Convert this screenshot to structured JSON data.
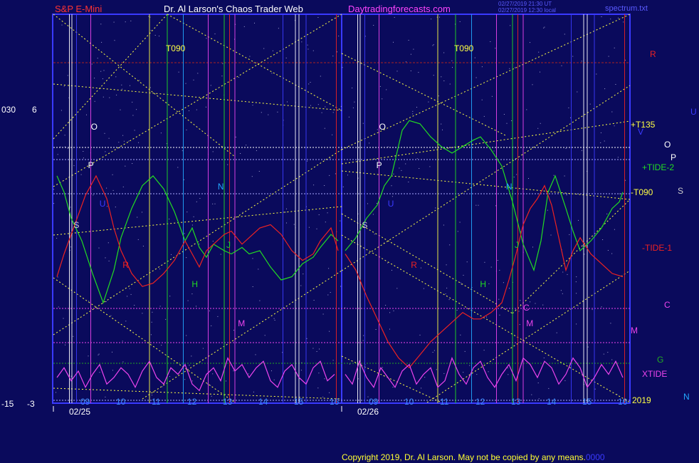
{
  "header": {
    "symbol": "S&P E-Mini",
    "title": "Dr. Al Larson's Chaos Trader Web",
    "site": "Daytradingforecasts.com",
    "stamp1": "02/27/2019 21:30 UT",
    "stamp2": "02/27/2019 12:30 local",
    "file": "spectrum.txt"
  },
  "colors": {
    "background": "#0a0a5c",
    "frame": "#3a3aff",
    "symbol": "#ff3333",
    "title": "#ffffff",
    "site": "#ff44ff",
    "green": "#22dd22",
    "red": "#ee2222",
    "magenta": "#ee44ee",
    "yellow": "#ffff44"
  },
  "left_axis": {
    "top_outer": "030",
    "top_inner": "6",
    "bottom_outer": "-15",
    "bottom_inner": "-3"
  },
  "right_labels": [
    "R",
    "U",
    "+T135",
    "V",
    "O",
    "P",
    "+TIDE-2",
    "-T090",
    "S",
    "-TIDE-1",
    "C",
    "M",
    "G",
    "XTIDE",
    "2019",
    "N"
  ],
  "copyright": "Copyright 2019, Dr. Al Larson. May not be copied by any means.",
  "copyright_tail": "0000",
  "chart_data": [
    {
      "type": "line",
      "title": "S&P E-Mini",
      "date": "02/25",
      "x_hours": [
        "09",
        "10",
        "11",
        "12",
        "13",
        "14",
        "15",
        "16"
      ],
      "ylim": [
        -3,
        6
      ],
      "annotations": [
        "T090",
        "O",
        "P",
        "S",
        "R",
        "U",
        "N",
        "H",
        "J",
        "M"
      ],
      "series": [
        {
          "name": "TIDE",
          "color": "green",
          "x": [
            8.2,
            8.4,
            8.6,
            8.9,
            9.2,
            9.5,
            9.8,
            10.0,
            10.3,
            10.6,
            10.9,
            11.2,
            11.5,
            11.8,
            12.0,
            12.2,
            12.4,
            12.6,
            12.9,
            13.1,
            13.4,
            13.6,
            13.9,
            14.2,
            14.5,
            14.8,
            15.1,
            15.4,
            15.6,
            15.9,
            16.1
          ],
          "values": [
            3.9,
            3.4,
            2.6,
            1.9,
            0.9,
            0.0,
            1.0,
            2.0,
            2.9,
            3.6,
            3.9,
            3.5,
            2.8,
            1.9,
            2.3,
            1.7,
            1.4,
            1.8,
            1.6,
            1.5,
            1.7,
            1.5,
            1.6,
            1.1,
            0.7,
            0.8,
            1.2,
            1.4,
            1.7,
            2.1,
            1.9
          ]
        },
        {
          "name": "TIDE-1",
          "color": "red",
          "x": [
            8.2,
            8.4,
            8.7,
            9.0,
            9.3,
            9.6,
            9.8,
            10.0,
            10.3,
            10.6,
            10.9,
            11.2,
            11.5,
            11.8,
            12.0,
            12.2,
            12.4,
            12.6,
            12.9,
            13.1,
            13.4,
            13.6,
            13.9,
            14.2,
            14.5,
            14.8,
            15.1,
            15.4,
            15.6,
            15.9,
            16.1
          ],
          "values": [
            0.8,
            1.5,
            2.4,
            3.3,
            3.9,
            3.2,
            2.3,
            1.6,
            0.9,
            0.5,
            0.6,
            0.9,
            1.3,
            1.9,
            1.5,
            1.1,
            1.6,
            1.8,
            2.1,
            2.2,
            1.8,
            2.0,
            2.3,
            2.4,
            2.1,
            1.6,
            1.3,
            1.5,
            1.9,
            2.3,
            1.6
          ]
        },
        {
          "name": "XTIDE",
          "color": "magenta",
          "x": [
            8.2,
            8.4,
            8.6,
            8.8,
            9.0,
            9.2,
            9.4,
            9.6,
            9.8,
            10.0,
            10.2,
            10.4,
            10.6,
            10.8,
            11.0,
            11.2,
            11.4,
            11.6,
            11.8,
            12.0,
            12.2,
            12.4,
            12.6,
            12.8,
            13.0,
            13.2,
            13.4,
            13.6,
            13.8,
            14.0,
            14.2,
            14.4,
            14.6,
            14.8,
            15.0,
            15.2,
            15.4,
            15.6,
            15.8,
            16.0
          ],
          "values": [
            -2.3,
            -2.0,
            -2.4,
            -2.1,
            -2.6,
            -2.2,
            -1.9,
            -2.5,
            -2.3,
            -2.0,
            -2.2,
            -2.6,
            -2.1,
            -1.8,
            -2.3,
            -2.5,
            -2.0,
            -2.2,
            -1.9,
            -2.5,
            -2.7,
            -2.2,
            -2.0,
            -2.4,
            -1.7,
            -2.1,
            -1.9,
            -2.3,
            -2.0,
            -1.8,
            -2.4,
            -2.6,
            -2.1,
            -1.9,
            -2.3,
            -2.5,
            -2.0,
            -1.8,
            -2.4,
            -2.2
          ]
        }
      ]
    },
    {
      "type": "line",
      "title": "S&P E-Mini",
      "date": "02/26",
      "x_hours": [
        "09",
        "10",
        "11",
        "12",
        "13",
        "14",
        "15",
        "16"
      ],
      "ylim": [
        -3,
        6
      ],
      "annotations": [
        "T090",
        "O",
        "P",
        "S",
        "R",
        "U",
        "N",
        "H",
        "J",
        "M",
        "C"
      ],
      "series": [
        {
          "name": "TIDE",
          "color": "green",
          "x": [
            8.2,
            8.5,
            8.8,
            9.1,
            9.3,
            9.5,
            9.8,
            10.0,
            10.3,
            10.6,
            10.9,
            11.2,
            11.5,
            11.8,
            12.0,
            12.3,
            12.6,
            12.9,
            13.2,
            13.5,
            13.7,
            13.9,
            14.1,
            14.4,
            14.6,
            14.8,
            15.1,
            15.4,
            15.7,
            15.9,
            16.0
          ],
          "values": [
            1.6,
            2.0,
            2.6,
            3.0,
            3.6,
            3.9,
            5.3,
            5.6,
            5.5,
            5.1,
            4.8,
            4.6,
            4.8,
            5.0,
            5.1,
            4.7,
            4.2,
            3.1,
            1.8,
            1.0,
            1.9,
            3.4,
            3.9,
            2.9,
            2.2,
            1.6,
            1.9,
            2.3,
            2.9,
            3.1,
            3.4
          ]
        },
        {
          "name": "TIDE-1",
          "color": "red",
          "x": [
            8.2,
            8.5,
            8.8,
            9.1,
            9.4,
            9.7,
            10.0,
            10.3,
            10.6,
            10.9,
            11.2,
            11.5,
            11.8,
            12.0,
            12.3,
            12.6,
            12.8,
            13.0,
            13.2,
            13.4,
            13.6,
            13.8,
            14.0,
            14.2,
            14.4,
            14.6,
            14.8,
            15.1,
            15.4,
            15.7,
            16.0
          ],
          "values": [
            1.5,
            1.0,
            0.2,
            -0.5,
            -1.2,
            -1.7,
            -2.0,
            -1.6,
            -1.2,
            -0.9,
            -0.6,
            -0.3,
            -0.5,
            -0.5,
            -0.3,
            0.0,
            0.7,
            1.5,
            2.4,
            2.9,
            3.2,
            3.6,
            3.0,
            2.0,
            1.0,
            1.6,
            2.0,
            1.5,
            1.2,
            0.9,
            0.8
          ]
        },
        {
          "name": "XTIDE",
          "color": "magenta",
          "x": [
            8.2,
            8.4,
            8.6,
            8.8,
            9.0,
            9.2,
            9.4,
            9.6,
            9.8,
            10.0,
            10.2,
            10.4,
            10.6,
            10.8,
            11.0,
            11.2,
            11.4,
            11.6,
            11.8,
            12.0,
            12.2,
            12.4,
            12.6,
            12.8,
            13.0,
            13.2,
            13.4,
            13.6,
            13.8,
            14.0,
            14.2,
            14.4,
            14.6,
            14.8,
            15.0,
            15.2,
            15.4,
            15.6,
            15.8,
            16.0
          ],
          "values": [
            -2.2,
            -2.5,
            -1.8,
            -2.3,
            -2.6,
            -2.0,
            -2.3,
            -2.6,
            -2.1,
            -1.9,
            -2.5,
            -2.2,
            -2.0,
            -2.6,
            -2.4,
            -1.7,
            -2.2,
            -2.5,
            -2.0,
            -1.8,
            -2.3,
            -2.6,
            -2.2,
            -1.9,
            -2.4,
            -1.7,
            -1.9,
            -2.3,
            -1.8,
            -2.0,
            -2.5,
            -2.2,
            -1.7,
            -2.0,
            -2.6,
            -2.3,
            -1.9,
            -2.2,
            -1.8,
            -2.3
          ]
        }
      ]
    }
  ]
}
